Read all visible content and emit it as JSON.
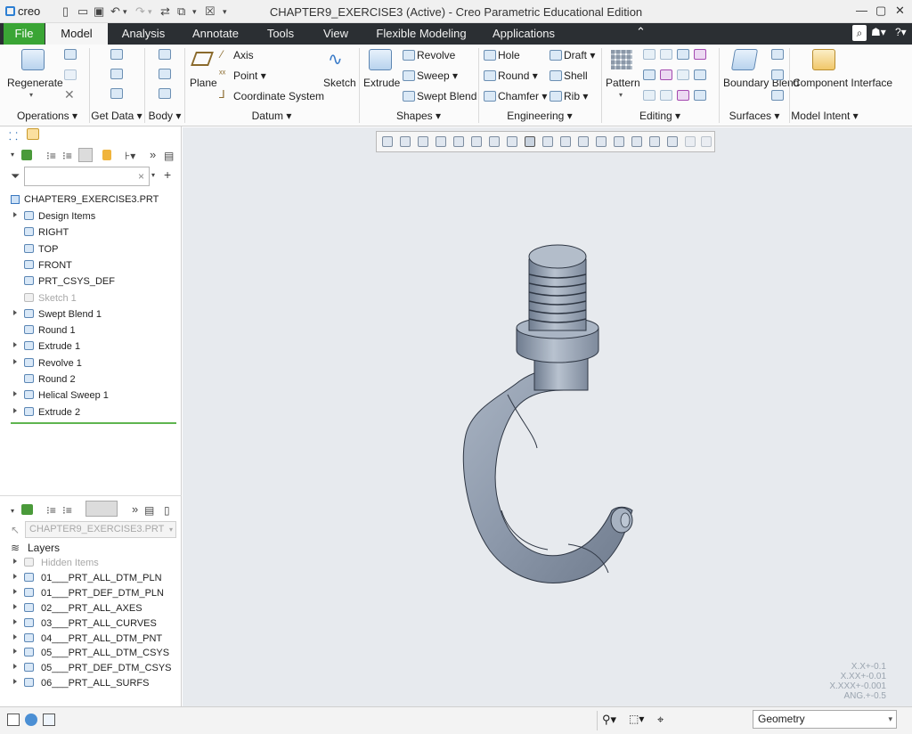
{
  "app": {
    "logo": "creo",
    "title": "CHAPTER9_EXERCISE3 (Active) - Creo Parametric Educational Edition"
  },
  "menu": {
    "tabs": [
      "File",
      "Model",
      "Analysis",
      "Annotate",
      "Tools",
      "View",
      "Flexible Modeling",
      "Applications"
    ],
    "active": "Model"
  },
  "ribbon": {
    "operations": {
      "regenerate": "Regenerate",
      "label": "Operations"
    },
    "get_data": {
      "label": "Get Data"
    },
    "body": {
      "label": "Body"
    },
    "datum": {
      "plane": "Plane",
      "axis": "Axis",
      "point": "Point",
      "csys": "Coordinate System",
      "sketch": "Sketch",
      "label": "Datum"
    },
    "shapes": {
      "extrude": "Extrude",
      "revolve": "Revolve",
      "sweep": "Sweep",
      "swept_blend": "Swept Blend",
      "label": "Shapes"
    },
    "engineering": {
      "hole": "Hole",
      "draft": "Draft",
      "round": "Round",
      "shell": "Shell",
      "chamfer": "Chamfer",
      "rib": "Rib",
      "label": "Engineering"
    },
    "editing": {
      "pattern": "Pattern",
      "label": "Editing"
    },
    "surfaces": {
      "boundary_blend": "Boundary Blend",
      "label": "Surfaces"
    },
    "model_intent": {
      "component_interface": "Component Interface",
      "label": "Model Intent"
    }
  },
  "model_tree": {
    "root": "CHAPTER9_EXERCISE3.PRT",
    "items": [
      {
        "label": "Design Items",
        "expandable": true,
        "muted": false
      },
      {
        "label": "RIGHT",
        "expandable": false,
        "muted": false
      },
      {
        "label": "TOP",
        "expandable": false,
        "muted": false
      },
      {
        "label": "FRONT",
        "expandable": false,
        "muted": false
      },
      {
        "label": "PRT_CSYS_DEF",
        "expandable": false,
        "muted": false
      },
      {
        "label": "Sketch 1",
        "expandable": false,
        "muted": true
      },
      {
        "label": "Swept Blend 1",
        "expandable": true,
        "muted": false
      },
      {
        "label": "Round 1",
        "expandable": false,
        "muted": false
      },
      {
        "label": "Extrude 1",
        "expandable": true,
        "muted": false
      },
      {
        "label": "Revolve 1",
        "expandable": true,
        "muted": false
      },
      {
        "label": "Round 2",
        "expandable": false,
        "muted": false
      },
      {
        "label": "Helical Sweep 1",
        "expandable": true,
        "muted": false
      },
      {
        "label": "Extrude 2",
        "expandable": true,
        "muted": false
      }
    ]
  },
  "layer_tree": {
    "selector": "CHAPTER9_EXERCISE3.PRT",
    "title": "Layers",
    "items": [
      {
        "label": "Hidden Items",
        "muted": true
      },
      {
        "label": "01___PRT_ALL_DTM_PLN",
        "muted": false
      },
      {
        "label": "01___PRT_DEF_DTM_PLN",
        "muted": false
      },
      {
        "label": "02___PRT_ALL_AXES",
        "muted": false
      },
      {
        "label": "03___PRT_ALL_CURVES",
        "muted": false
      },
      {
        "label": "04___PRT_ALL_DTM_PNT",
        "muted": false
      },
      {
        "label": "05___PRT_ALL_DTM_CSYS",
        "muted": false
      },
      {
        "label": "05___PRT_DEF_DTM_CSYS",
        "muted": false
      },
      {
        "label": "06___PRT_ALL_SURFS",
        "muted": false
      }
    ]
  },
  "tolerance": [
    "X.X+-0.1",
    "X.XX+-0.01",
    "X.XXX+-0.001",
    "ANG.+-0.5"
  ],
  "status": {
    "filter": "Geometry"
  },
  "colors": {
    "file_tab": "#3aa535",
    "menubar": "#2b2f33",
    "graphics_bg": "#e7eaee",
    "part": "#8c98aa"
  }
}
